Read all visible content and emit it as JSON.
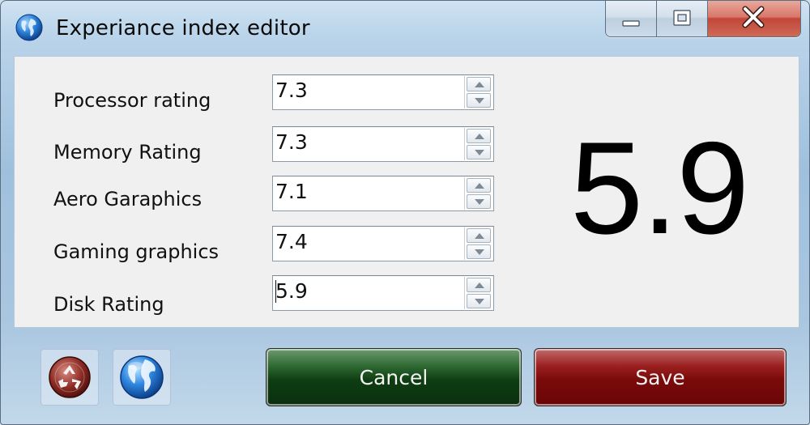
{
  "window": {
    "title": "Experiance index editor",
    "icon": "globe-icon",
    "controls": {
      "minimize": "minimize-icon",
      "maximize": "maximize-icon",
      "close": "close-icon"
    }
  },
  "ratings": [
    {
      "label": "Processor rating",
      "value": "7.3"
    },
    {
      "label": "Memory Rating",
      "value": "7.3"
    },
    {
      "label": "Aero Garaphics",
      "value": "7.1"
    },
    {
      "label": "Gaming graphics",
      "value": "7.4"
    },
    {
      "label": "Disk Rating",
      "value": "5.9"
    }
  ],
  "score": {
    "value": "5.9"
  },
  "toolbar": {
    "reset_icon": "recycle-icon",
    "web_icon": "globe-icon"
  },
  "buttons": {
    "cancel": "Cancel",
    "save": "Save"
  },
  "colors": {
    "cancel_bg": "#0e3d12",
    "save_bg": "#7a0a0a",
    "client_bg": "#f0f0f0"
  }
}
